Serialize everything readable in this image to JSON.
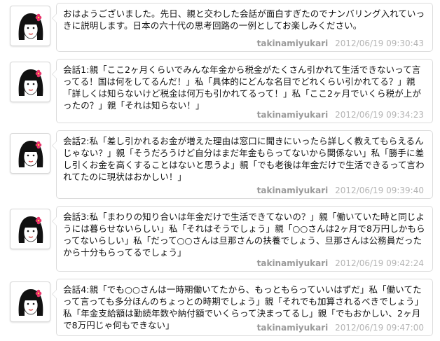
{
  "colors": {
    "bubble_border": "#dcdcdc",
    "meta": "#b4b4b4",
    "username": "#9a9a9a",
    "flower": "#e8336b"
  },
  "avatar_icon": "girl-avatar-icon",
  "tweets": [
    {
      "text": "おはようございました。先日、親と交わした会話が面白すぎたのでナンバリング入れていっきに説明します。日本の六十代の思考回路の一例としてお楽しみください。",
      "user": "takinamiyukari",
      "time": "2012/06/19 09:30:43"
    },
    {
      "text": "会話1:親「ここ2ヶ月くらいでみんな年金から税金がたくさん引かれて生活できないって言ってる！国は何をしてるんだ！」私「具体的にどんな名目でどれくらい引かれてる？」親「詳しくは知らないけど税金は何万も引かれてるって！」私「ここ2ヶ月でいくら税が上がったの？」親「それは知らない！」",
      "user": "takinamiyukari",
      "time": "2012/06/19 09:34:23"
    },
    {
      "text": "会話2:私「差し引かれるお金が増えた理由は窓口に聞きにいったら詳しく教えてもらえるんじゃない？」親「そうだろうけど自分はまだ年金もらってないから関係ない」私「勝手に差し引くお金を高くすることはないと思うよ」親「でも老後は年金だけで生活できるって言われてたのに現状はおかしい！」",
      "user": "takinamiyukari",
      "time": "2012/06/19 09:39:40"
    },
    {
      "text": "会話3:私「まわりの知り合いは年金だけで生活できてないの？」親「働いていた時と同じようには暮らせないらしい」私「それはそうでしょう」親「○○さんは2ヶ月で8万円しかもらってないらしい」私「だって○○さんは旦那さんの扶養でしょう、旦那さんは公務員だったから十分もらってるでしょう」",
      "user": "takinamiyukari",
      "time": "2012/06/19 09:42:24"
    },
    {
      "text": "会話4:親「でも○○さんは一時期働いてたから、もっともらっていいはずだ」私「働いてたって言っても多分ほんのちょっとの時期でしょう」親「それでも加算されるべきでしょう」私「年金支給額は勤続年数や納付額でいくらって決まってるし」親「でもおかしい、2ヶ月で8万円じゃ何もできない」",
      "user": "takinamiyukari",
      "time": "2012/06/19 09:47:00"
    }
  ]
}
